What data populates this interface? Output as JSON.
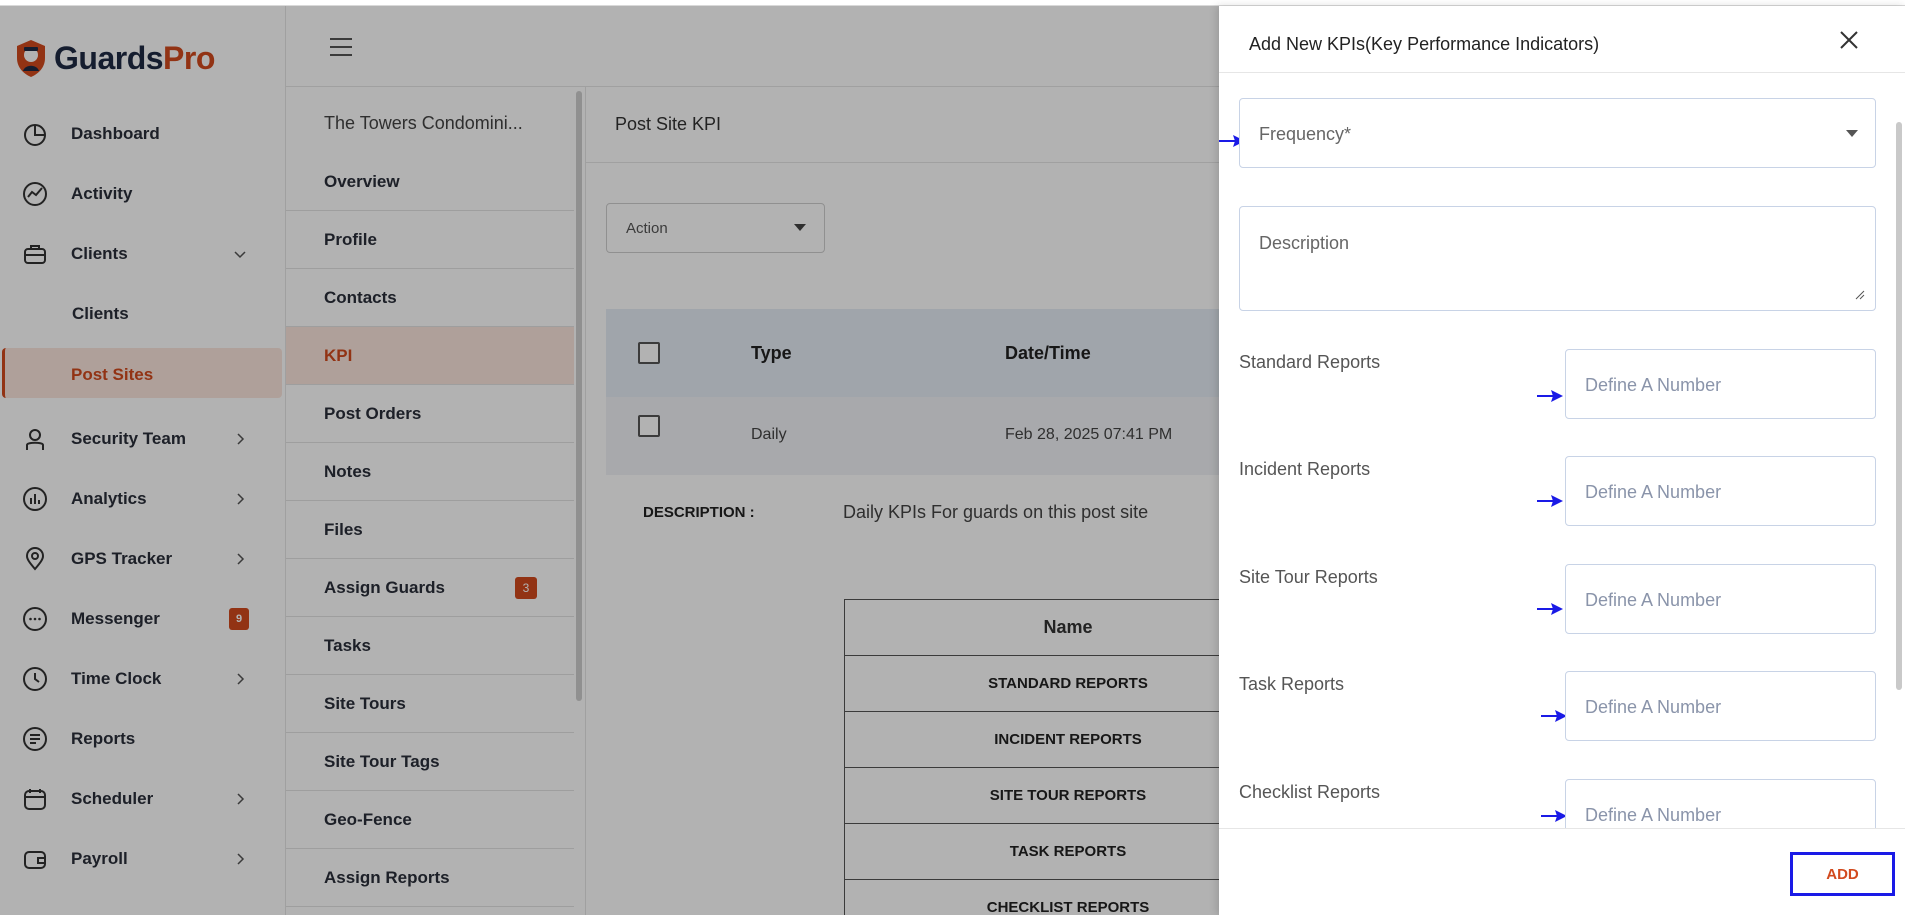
{
  "brand": {
    "name_part1": "Guards",
    "name_part2": "Pro"
  },
  "sidebar": {
    "items": [
      {
        "label": "Dashboard"
      },
      {
        "label": "Activity"
      },
      {
        "label": "Clients"
      },
      {
        "label": "Clients"
      },
      {
        "label": "Post Sites"
      },
      {
        "label": "Security Team"
      },
      {
        "label": "Analytics"
      },
      {
        "label": "GPS Tracker"
      },
      {
        "label": "Messenger",
        "badge": "9"
      },
      {
        "label": "Time Clock"
      },
      {
        "label": "Reports"
      },
      {
        "label": "Scheduler"
      },
      {
        "label": "Payroll"
      }
    ]
  },
  "subnav": {
    "title": "The Towers Condomini...",
    "items": [
      {
        "label": "Overview"
      },
      {
        "label": "Profile"
      },
      {
        "label": "Contacts"
      },
      {
        "label": "KPI"
      },
      {
        "label": "Post Orders"
      },
      {
        "label": "Notes"
      },
      {
        "label": "Files"
      },
      {
        "label": "Assign Guards",
        "badge": "3"
      },
      {
        "label": "Tasks"
      },
      {
        "label": "Site Tours"
      },
      {
        "label": "Site Tour Tags"
      },
      {
        "label": "Geo-Fence"
      },
      {
        "label": "Assign Reports"
      }
    ]
  },
  "main": {
    "title": "Post Site KPI",
    "action_label": "Action",
    "table": {
      "headers": [
        "Type",
        "Date/Time"
      ],
      "row": {
        "type": "Daily",
        "datetime": "Feb 28, 2025 07:41 PM"
      }
    },
    "description_label": "DESCRIPTION :",
    "description_value": "Daily KPIs For guards on this post site",
    "kpi_table": {
      "header": "Name",
      "rows": [
        "STANDARD REPORTS",
        "INCIDENT REPORTS",
        "SITE TOUR REPORTS",
        "TASK REPORTS",
        "CHECKLIST REPORTS"
      ]
    }
  },
  "drawer": {
    "title": "Add New KPIs(Key Performance Indicators)",
    "frequency_placeholder": "Frequency*",
    "description_placeholder": "Description",
    "fields": [
      {
        "label": "Standard Reports",
        "placeholder": "Define A Number"
      },
      {
        "label": "Incident Reports",
        "placeholder": "Define A Number"
      },
      {
        "label": "Site Tour Reports",
        "placeholder": "Define A Number"
      },
      {
        "label": "Task Reports",
        "placeholder": "Define A Number"
      },
      {
        "label": "Checklist Reports",
        "placeholder": "Define A Number"
      }
    ],
    "add_label": "ADD"
  },
  "colors": {
    "brand": "#d24a1e",
    "highlight": "#1a1ae6"
  }
}
